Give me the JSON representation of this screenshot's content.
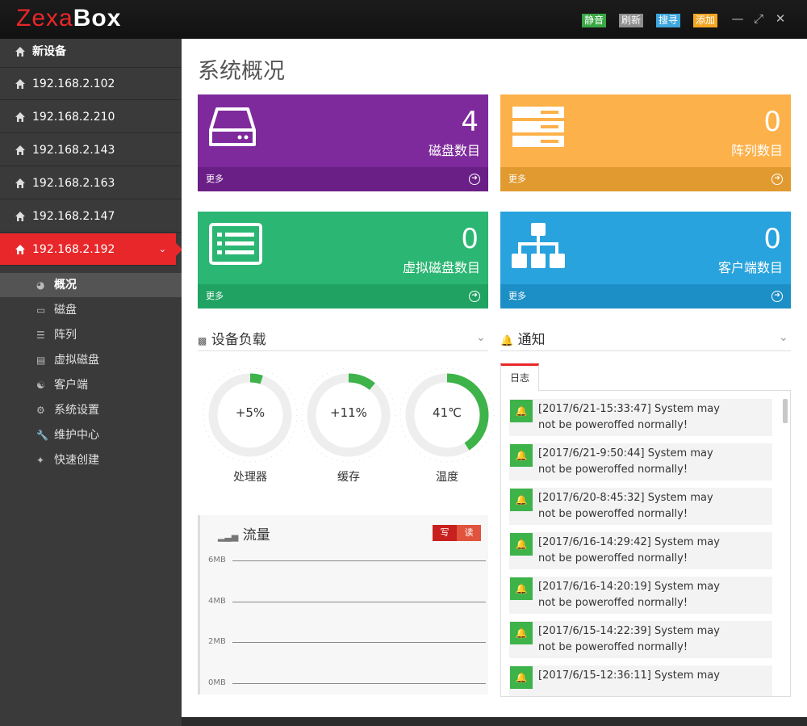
{
  "app": {
    "logo_part1": "Zexa",
    "logo_part2": "Box"
  },
  "toolbar": {
    "buttons": [
      {
        "label": "静音",
        "color": "#3aa845"
      },
      {
        "label": "刷新",
        "color": "#8e8e8e"
      },
      {
        "label": "搜寻",
        "color": "#3fa7de"
      },
      {
        "label": "添加",
        "color": "#f2a623"
      }
    ]
  },
  "sidebar": {
    "devices": [
      {
        "label": "新设备"
      },
      {
        "label": "192.168.2.102"
      },
      {
        "label": "192.168.2.210"
      },
      {
        "label": "192.168.2.143"
      },
      {
        "label": "192.168.2.163"
      },
      {
        "label": "192.168.2.147"
      },
      {
        "label": "192.168.2.192"
      }
    ],
    "menu": [
      {
        "label": "概况",
        "icon": "dashboard-icon"
      },
      {
        "label": "磁盘",
        "icon": "disk-icon"
      },
      {
        "label": "阵列",
        "icon": "array-icon"
      },
      {
        "label": "虚拟磁盘",
        "icon": "virtual-disk-icon"
      },
      {
        "label": "客户端",
        "icon": "client-icon"
      },
      {
        "label": "系统设置",
        "icon": "settings-icon"
      },
      {
        "label": "维护中心",
        "icon": "wrench-icon"
      },
      {
        "label": "快速创建",
        "icon": "magic-wand-icon"
      }
    ]
  },
  "main": {
    "title": "系统概况",
    "cards": [
      {
        "value": "4",
        "label": "磁盘数目",
        "more": "更多",
        "color": "#7e2a9c",
        "foot_color": "#6a1f86"
      },
      {
        "value": "0",
        "label": "阵列数目",
        "more": "更多",
        "color": "#fcb14a",
        "foot_color": "#e09a2f"
      },
      {
        "value": "0",
        "label": "虚拟磁盘数目",
        "more": "更多",
        "color": "#2bb673",
        "foot_color": "#1fa262"
      },
      {
        "value": "0",
        "label": "客户端数目",
        "more": "更多",
        "color": "#29a3dd",
        "foot_color": "#1c8fc6"
      }
    ],
    "load": {
      "title": "设备负载",
      "gauges": [
        {
          "value": "+5%",
          "label": "处理器",
          "percent": 5
        },
        {
          "value": "+11%",
          "label": "缓存",
          "percent": 11
        },
        {
          "value": "41℃",
          "label": "温度",
          "percent": 41
        }
      ]
    },
    "traffic": {
      "title": "流量",
      "legend_write": "写",
      "legend_read": "读",
      "y_ticks": [
        "6MB",
        "4MB",
        "2MB",
        "0MB"
      ]
    },
    "notice": {
      "title": "通知",
      "tab": "日志",
      "logs": [
        {
          "line1": "[2017/6/21-15:33:47] System may",
          "line2": "not be poweroffed normally!"
        },
        {
          "line1": "[2017/6/21-9:50:44] System may",
          "line2": "not be poweroffed normally!"
        },
        {
          "line1": "[2017/6/20-8:45:32] System may",
          "line2": "not be poweroffed normally!"
        },
        {
          "line1": "[2017/6/16-14:29:42] System may",
          "line2": "not be poweroffed normally!"
        },
        {
          "line1": "[2017/6/16-14:20:19] System may",
          "line2": "not be poweroffed normally!"
        },
        {
          "line1": "[2017/6/15-14:22:39] System may",
          "line2": "not be poweroffed normally!"
        },
        {
          "line1": "[2017/6/15-12:36:11] System may",
          "line2": ""
        }
      ]
    }
  }
}
